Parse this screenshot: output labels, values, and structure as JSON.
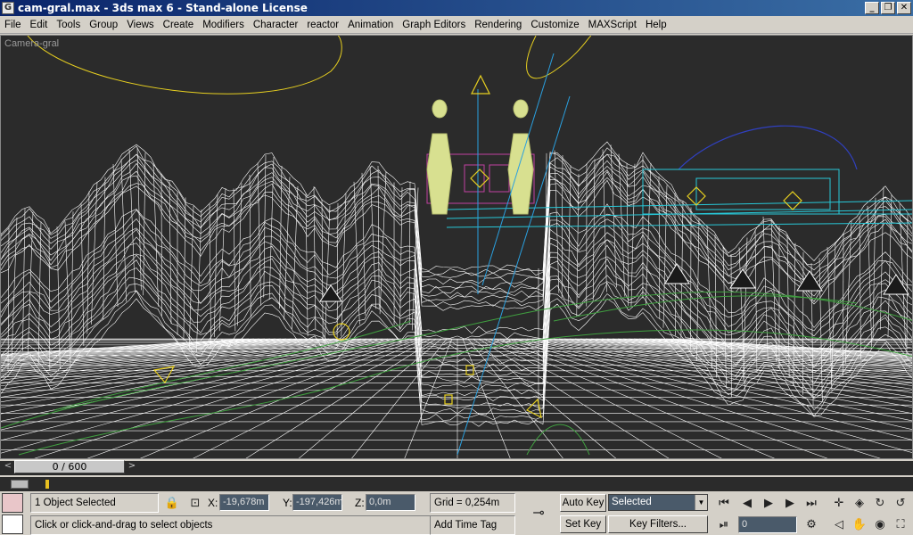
{
  "window": {
    "app_icon": "3ds-max-icon",
    "title": "cam-gral.max - 3ds max 6 - Stand-alone License",
    "minimize": "_",
    "restore": "❐",
    "close": "✕"
  },
  "menu": [
    "File",
    "Edit",
    "Tools",
    "Group",
    "Views",
    "Create",
    "Modifiers",
    "Character",
    "reactor",
    "Animation",
    "Graph Editors",
    "Rendering",
    "Customize",
    "MAXScript",
    "Help"
  ],
  "viewport": {
    "label": "Camera-gral",
    "background": "#2b2b2b"
  },
  "time_slider": {
    "prev": "<",
    "next": ">",
    "value": "0 / 600"
  },
  "status": {
    "selection": "1 Object Selected",
    "prompt": "Click or click-and-drag to select objects",
    "x_label": "X:",
    "x_value": "-19,678m",
    "y_label": "Y:",
    "y_value": "-197,426m",
    "z_label": "Z:",
    "z_value": "0,0m",
    "grid": "Grid = 0,254m",
    "add_time_tag": "Add Time Tag",
    "auto_key": "Auto Key",
    "set_key": "Set Key",
    "key_mode": "Selected",
    "key_filters": "Key Filters...",
    "frame": "0"
  },
  "colors": {
    "titlebar_start": "#0a246a",
    "titlebar_end": "#3a6ea5",
    "wire_white": "#ffffff",
    "wire_cyan": "#28c8d8",
    "wire_yellow": "#e8d020",
    "wire_green": "#40a040",
    "wire_magenta": "#c040a0",
    "figure_fill": "#d8e090"
  }
}
